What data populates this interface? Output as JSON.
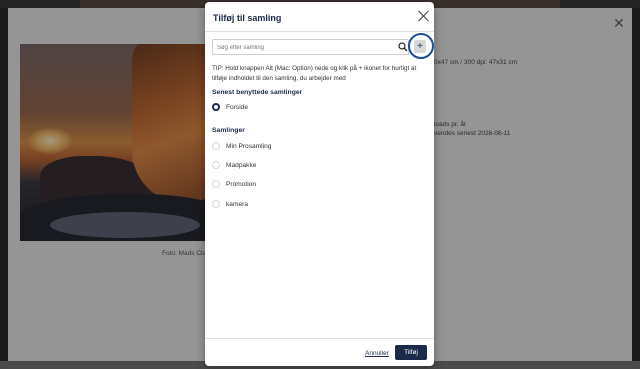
{
  "background": {
    "caption": "Foto: Mads Claus",
    "meta_lines": [
      "0x47 cm / 300 dpi: 47x31 cm",
      "loads pr. år",
      "vendes senest 2026-06-11"
    ],
    "close_icon": "close-icon"
  },
  "modal": {
    "title": "Tilføj til samling",
    "search_placeholder": "Søg efter samling",
    "add_button_label": "+",
    "tip": "TIP: Hold knappen Alt (Mac: Option) nede og klik på + ikonet for hurtigt at tilføje indholdet til den samling, du arbejder med",
    "recent_heading": "Senest benyttede samlinger",
    "recent_items": [
      {
        "label": "Forside",
        "checked": true
      }
    ],
    "collections_heading": "Samlinger",
    "collections": [
      {
        "label": "Min Prosamling"
      },
      {
        "label": "Madpakke"
      },
      {
        "label": "Promotion"
      },
      {
        "label": "kamera"
      }
    ],
    "cancel_label": "Annuller",
    "ok_label": "Tilføj"
  },
  "colors": {
    "accent": "#1b2a4a",
    "highlight_ring": "#1c4f99"
  }
}
